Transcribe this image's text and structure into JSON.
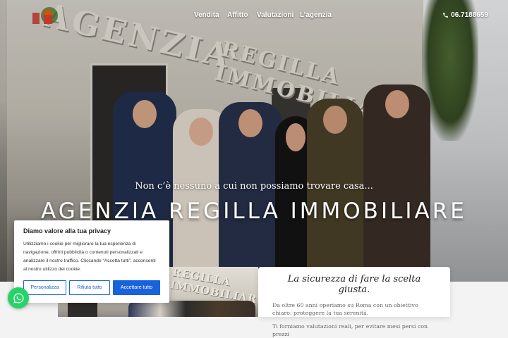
{
  "nav": {
    "items": [
      "Vendita",
      "Affitto",
      "Valutazioni",
      "L’agenzia"
    ],
    "phone": "06.7188659"
  },
  "hero": {
    "sign": "AGENZIA",
    "sign2": "REGILLA IMMOBILIARE",
    "tagline": "Non c’è nessuno a cui non possiamo trovare casa...",
    "title": "AGENZIA REGILLA IMMOBILIARE"
  },
  "photo_card": {
    "sign": "REGILLA IMMOBILIARE"
  },
  "about": {
    "heading": "La sicurezza di fare la scelta giusta.",
    "para1": "Da oltre 60 anni operiamo su Roma con un obiettivo chiaro: proteggere la tua serenità.",
    "para2": "Ti forniamo valutazioni reali, per evitare mesi persi con prezzi"
  },
  "cookie": {
    "title": "Diamo valore alla tua privacy",
    "text": "Utilizziamo i cookie per migliorare la tua esperienza di navigazione, offrirti pubblicità o contenuti personalizzati e analizzare il nostro traffico. Cliccando “Accetta tutti”, acconsenti al nostro utilizzo dei cookie.",
    "customize": "Personalizza",
    "reject": "Rifiuta tutto",
    "accept": "Accettare tutto"
  },
  "colors": {
    "cookie_accent": "#1863dc",
    "whatsapp": "#25d366"
  },
  "icons": {
    "phone": "phone-icon",
    "whatsapp": "whatsapp-icon",
    "logo": "agency-logo"
  }
}
